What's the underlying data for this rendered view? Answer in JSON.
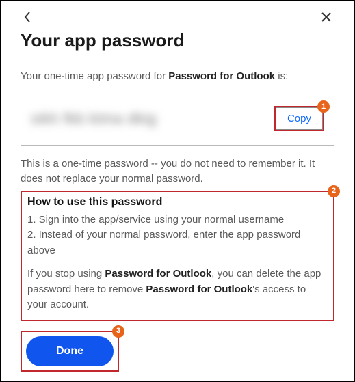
{
  "title": "Your app password",
  "intro_prefix": "Your one-time app password for ",
  "app_name": "Password for Outlook",
  "intro_suffix": " is:",
  "password_value": "sikh fkb ktma dkig",
  "copy_label": "Copy",
  "note_text": "This is a one-time password -- you do not need to remember it. It does not replace your normal password.",
  "howto_title": "How to use this password",
  "howto_step1": "1. Sign into the app/service using your normal username",
  "howto_step2": "2. Instead of your normal password, enter the app password above",
  "delete_pre": "If you stop using ",
  "delete_mid": ", you can delete the app password here to remove ",
  "delete_post": "'s access to your account.",
  "done_label": "Done",
  "badges": {
    "copy": "1",
    "howto": "2",
    "done": "3"
  }
}
